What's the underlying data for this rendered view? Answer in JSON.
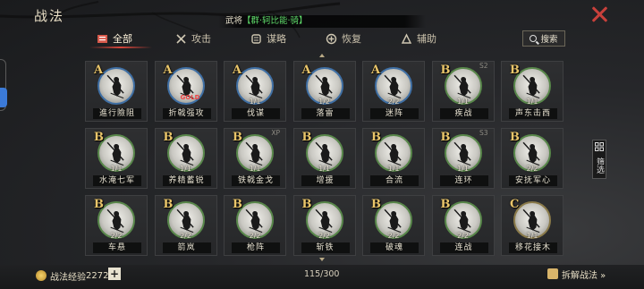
{
  "header": {
    "title": "战法"
  },
  "notice": {
    "prefix": "武将",
    "highlight": "【群·轲比能·骑】"
  },
  "tabs": [
    {
      "label": "全部",
      "icon": "book-icon",
      "active": true
    },
    {
      "label": "攻击",
      "icon": "crossed-swords-icon",
      "active": false
    },
    {
      "label": "谋略",
      "icon": "scroll-icon",
      "active": false
    },
    {
      "label": "恢复",
      "icon": "heal-icon",
      "active": false
    },
    {
      "label": "辅助",
      "icon": "support-icon",
      "active": false
    }
  ],
  "search": {
    "label": "搜索"
  },
  "filter": {
    "label": "筛选"
  },
  "cards": [
    {
      "grade": "A",
      "level": "",
      "name": "進行險阻",
      "ring": "blue",
      "tag": "",
      "mark": ""
    },
    {
      "grade": "A",
      "level": "",
      "name": "折戟强攻",
      "ring": "blue",
      "tag": "",
      "mark": "GOLD"
    },
    {
      "grade": "A",
      "level": "1/1",
      "name": "伐谋",
      "ring": "blue",
      "tag": "",
      "mark": ""
    },
    {
      "grade": "A",
      "level": "1/2",
      "name": "落雷",
      "ring": "blue",
      "tag": "",
      "mark": ""
    },
    {
      "grade": "A",
      "level": "2/2",
      "name": "迷阵",
      "ring": "blue",
      "tag": "",
      "mark": ""
    },
    {
      "grade": "B",
      "level": "1/1",
      "name": "疾战",
      "ring": "green",
      "tag": "S2",
      "mark": ""
    },
    {
      "grade": "B",
      "level": "1/1",
      "name": "声东击西",
      "ring": "green",
      "tag": "",
      "mark": ""
    },
    {
      "grade": "B",
      "level": "1/1",
      "name": "水淹七军",
      "ring": "green",
      "tag": "",
      "mark": ""
    },
    {
      "grade": "B",
      "level": "1/1",
      "name": "养精蓄锐",
      "ring": "green",
      "tag": "",
      "mark": ""
    },
    {
      "grade": "B",
      "level": "1/1",
      "name": "铁戟金戈",
      "ring": "green",
      "tag": "XP",
      "mark": ""
    },
    {
      "grade": "B",
      "level": "1/1",
      "name": "增援",
      "ring": "green",
      "tag": "",
      "mark": ""
    },
    {
      "grade": "B",
      "level": "1/1",
      "name": "合流",
      "ring": "green",
      "tag": "",
      "mark": ""
    },
    {
      "grade": "B",
      "level": "1/1",
      "name": "连环",
      "ring": "green",
      "tag": "S3",
      "mark": ""
    },
    {
      "grade": "B",
      "level": "2/2",
      "name": "安抚军心",
      "ring": "green",
      "tag": "",
      "mark": ""
    },
    {
      "grade": "B",
      "level": "2/2",
      "name": "车悬",
      "ring": "green",
      "tag": "",
      "mark": ""
    },
    {
      "grade": "B",
      "level": "2/2",
      "name": "箭岚",
      "ring": "green",
      "tag": "",
      "mark": ""
    },
    {
      "grade": "B",
      "level": "2/2",
      "name": "枪阵",
      "ring": "green",
      "tag": "",
      "mark": ""
    },
    {
      "grade": "B",
      "level": "2/2",
      "name": "斩铁",
      "ring": "green",
      "tag": "",
      "mark": ""
    },
    {
      "grade": "B",
      "level": "2/2",
      "name": "破魂",
      "ring": "green",
      "tag": "",
      "mark": ""
    },
    {
      "grade": "B",
      "level": "2/2",
      "name": "连战",
      "ring": "green",
      "tag": "",
      "mark": ""
    },
    {
      "grade": "C",
      "level": "1/1",
      "name": "移花接木",
      "ring": "gold",
      "tag": "",
      "mark": ""
    }
  ],
  "footer": {
    "exp_label": "战法经验",
    "exp_value": "2272",
    "plus": "+",
    "count": "115/300",
    "decompose": "拆解战法 »"
  },
  "colors": {
    "accent": "#d6453a",
    "grade": "#e9c56a",
    "ring_a": "#3f6fa4",
    "ring_b": "#58874a",
    "highlight": "#5fdc6a"
  }
}
